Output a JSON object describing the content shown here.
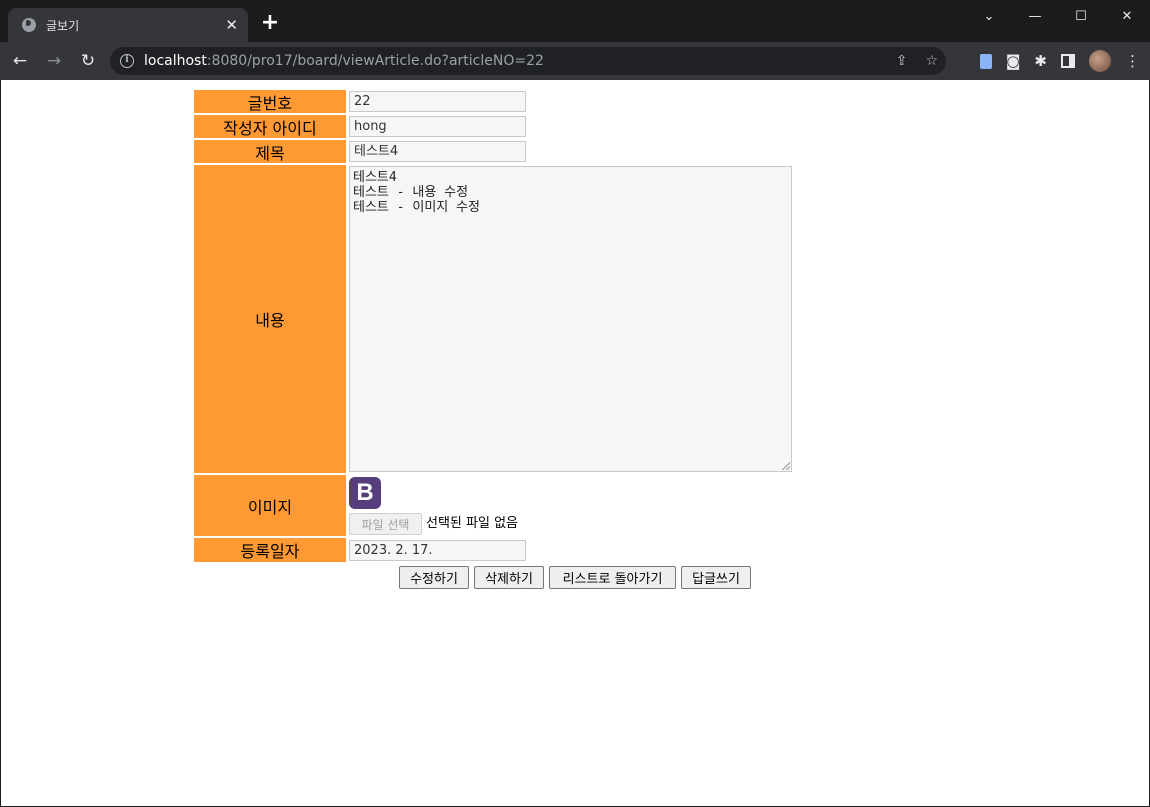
{
  "browser": {
    "tab_title": "글보기",
    "tab_close": "✕",
    "new_tab": "+",
    "url_host": "localhost",
    "url_rest": ":8080/pro17/board/viewArticle.do?articleNO=22"
  },
  "article": {
    "labels": {
      "article_no": "글번호",
      "writer_id": "작성자 아이디",
      "title": "제목",
      "content": "내용",
      "image": "이미지",
      "write_date": "등록일자"
    },
    "values": {
      "article_no": "22",
      "writer_id": "hong",
      "title": "테스트4",
      "content": "테스트4\n테스트 - 내용 수정\n테스트 - 이미지 수정",
      "write_date": "2023. 2. 17."
    },
    "image_logo_letter": "B",
    "file_button": "파일 선택",
    "file_none": "선택된 파일 없음"
  },
  "buttons": {
    "modify": "수정하기",
    "delete": "삭제하기",
    "back_to_list": "리스트로 돌아가기",
    "reply": "답글쓰기"
  },
  "colors": {
    "label_bg": "#ff9933",
    "logo_bg": "#563d7c"
  }
}
